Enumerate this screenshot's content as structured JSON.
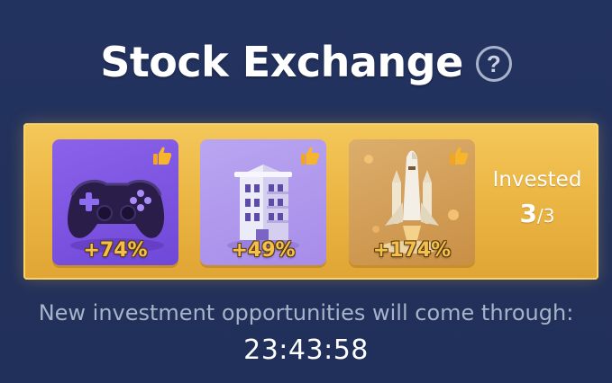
{
  "header": {
    "title": "Stock Exchange",
    "help_symbol": "?",
    "help_icon": "question-circle-icon"
  },
  "investments": [
    {
      "category": "gaming",
      "icon": "gamepad-icon",
      "percent": "+74%",
      "badge_icon": "thumbs-up-icon"
    },
    {
      "category": "real-estate",
      "icon": "building-icon",
      "percent": "+49%",
      "badge_icon": "thumbs-up-icon"
    },
    {
      "category": "space",
      "icon": "rocket-icon",
      "percent": "+174%",
      "badge_icon": "thumbs-up-icon"
    }
  ],
  "invested": {
    "label": "Invested",
    "current": "3",
    "total": "/3"
  },
  "notice": "New investment opportunities will come through:",
  "timer": "23:43:58",
  "colors": {
    "background": "#22325a",
    "panel_gold": "#ecb745",
    "percent_text": "#f4c04a",
    "notice_text": "#a8b2c8",
    "card_game": "#7b52e2",
    "card_realty": "#b09aee",
    "card_space": "#d49f58"
  }
}
